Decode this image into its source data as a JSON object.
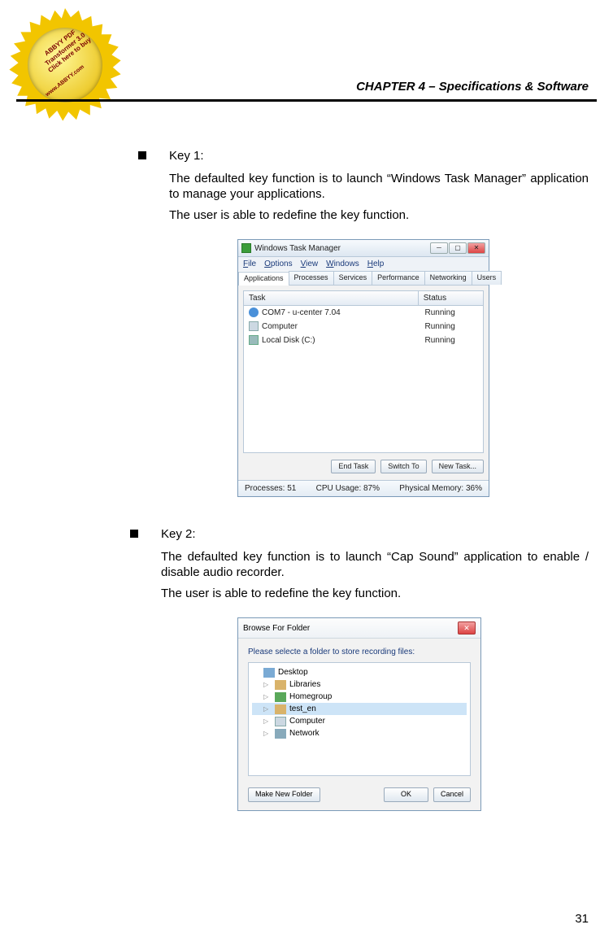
{
  "badge": {
    "line1": "ABBYY PDF Transformer 3.0",
    "line2": "Click here to buy",
    "line3": "www.ABBYY.com"
  },
  "chapter_header": "CHAPTER 4 – Specifications & Software",
  "key1": {
    "title": "Key 1:",
    "desc1": "The defaulted key function is to launch “Windows Task Manager” application to manage your applications.",
    "desc2": "The user is able to redefine the key function."
  },
  "taskmgr": {
    "title": "Windows Task Manager",
    "menus": [
      "File",
      "Options",
      "View",
      "Windows",
      "Help"
    ],
    "tabs": [
      "Applications",
      "Processes",
      "Services",
      "Performance",
      "Networking",
      "Users"
    ],
    "col_task": "Task",
    "col_status": "Status",
    "rows": [
      {
        "name": "COM7 - u-center 7.04",
        "status": "Running"
      },
      {
        "name": "Computer",
        "status": "Running"
      },
      {
        "name": "Local Disk (C:)",
        "status": "Running"
      }
    ],
    "btn_endtask": "End Task",
    "btn_switchto": "Switch To",
    "btn_newtask": "New Task...",
    "status_processes": "Processes: 51",
    "status_cpu": "CPU Usage: 87%",
    "status_mem": "Physical Memory: 36%"
  },
  "key2": {
    "title": "Key 2:",
    "desc1": "The defaulted key function is to launch “Cap Sound” application to enable / disable audio recorder.",
    "desc2": "The user is able to redefine the key function."
  },
  "browse": {
    "title": "Browse For Folder",
    "instr": "Please selecte a folder to store recording files:",
    "items": [
      {
        "name": "Desktop",
        "cls": "desktop",
        "sub": false,
        "sel": false,
        "arrow": ""
      },
      {
        "name": "Libraries",
        "cls": "lib",
        "sub": true,
        "sel": false,
        "arrow": "▷"
      },
      {
        "name": "Homegroup",
        "cls": "home",
        "sub": true,
        "sel": false,
        "arrow": "▷"
      },
      {
        "name": "test_en",
        "cls": "user",
        "sub": true,
        "sel": true,
        "arrow": "▷"
      },
      {
        "name": "Computer",
        "cls": "comp",
        "sub": true,
        "sel": false,
        "arrow": "▷"
      },
      {
        "name": "Network",
        "cls": "net",
        "sub": true,
        "sel": false,
        "arrow": "▷"
      }
    ],
    "btn_newfolder": "Make New Folder",
    "btn_ok": "OK",
    "btn_cancel": "Cancel"
  },
  "page_number": "31"
}
